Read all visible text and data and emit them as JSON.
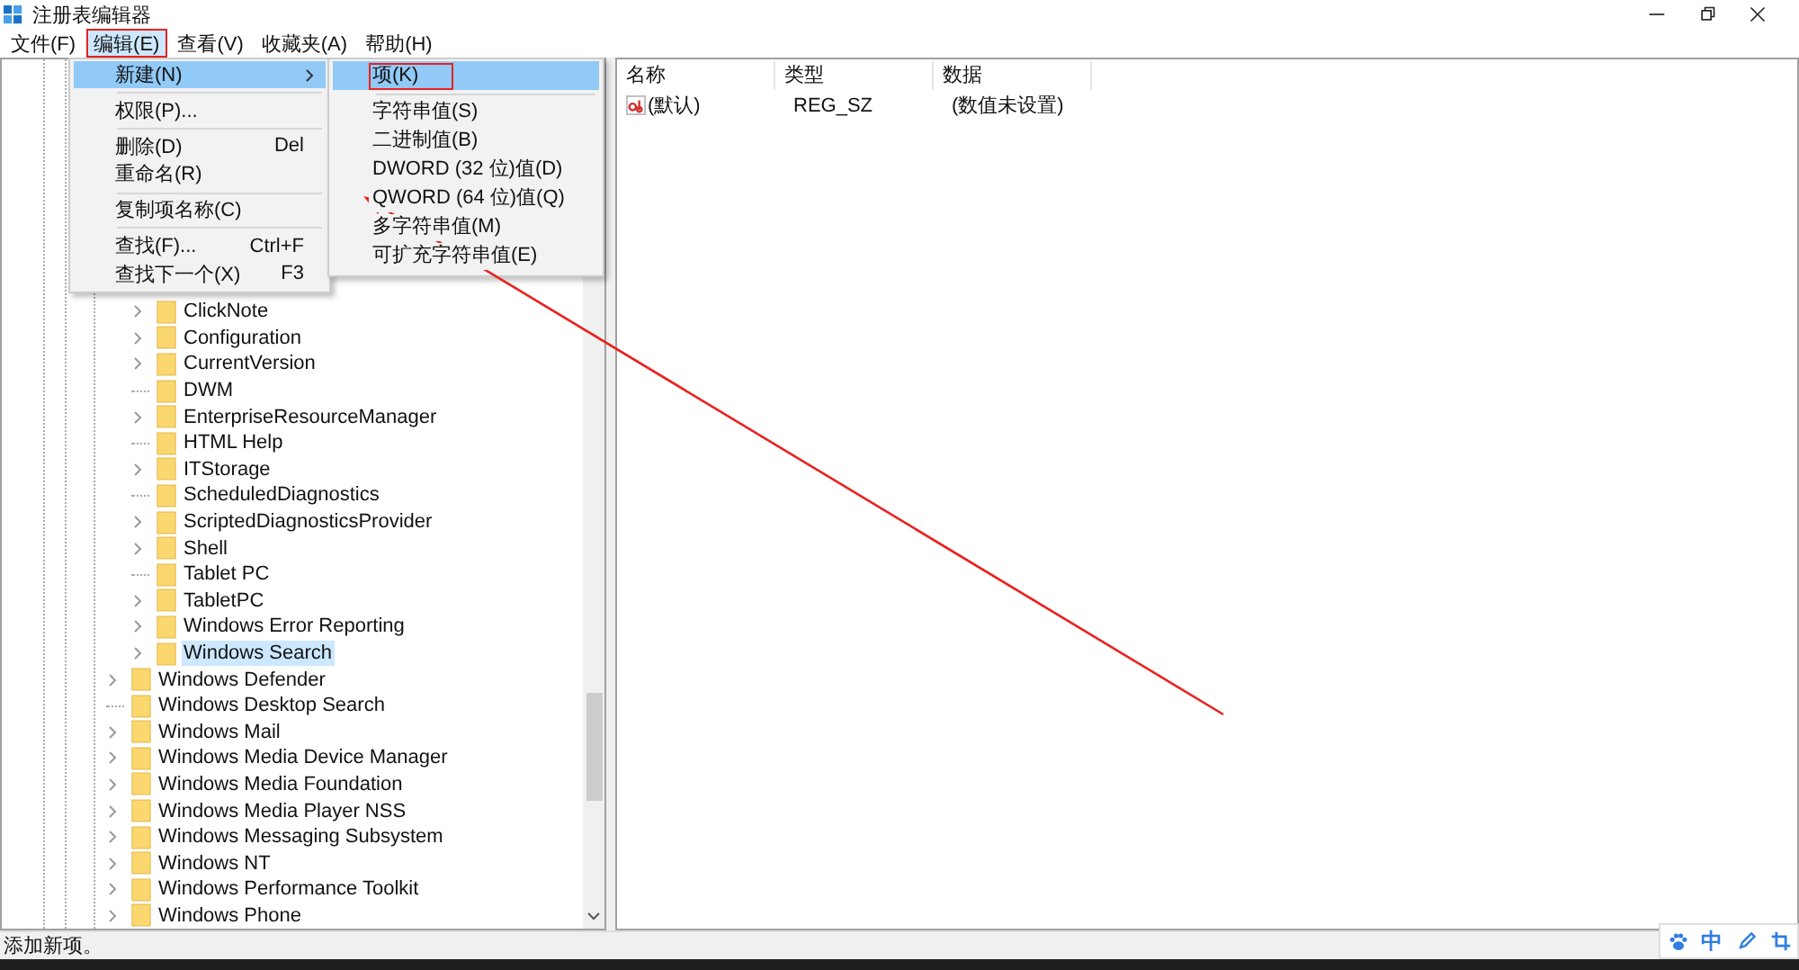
{
  "window": {
    "title": "注册表编辑器"
  },
  "menubar": [
    {
      "label": "文件(F)",
      "open": false,
      "annotated": false
    },
    {
      "label": "编辑(E)",
      "open": true,
      "annotated": true
    },
    {
      "label": "查看(V)",
      "open": false,
      "annotated": false
    },
    {
      "label": "收藏夹(A)",
      "open": false,
      "annotated": false
    },
    {
      "label": "帮助(H)",
      "open": false,
      "annotated": false
    }
  ],
  "edit_menu": [
    {
      "kind": "item",
      "label": "新建(N)",
      "submenu": true,
      "highlighted": true
    },
    {
      "kind": "separator"
    },
    {
      "kind": "item",
      "label": "权限(P)...",
      "submenu": false,
      "highlighted": false
    },
    {
      "kind": "separator"
    },
    {
      "kind": "item",
      "label": "删除(D)",
      "shortcut": "Del",
      "submenu": false,
      "highlighted": false
    },
    {
      "kind": "item",
      "label": "重命名(R)",
      "submenu": false,
      "highlighted": false
    },
    {
      "kind": "separator"
    },
    {
      "kind": "item",
      "label": "复制项名称(C)",
      "submenu": false,
      "highlighted": false
    },
    {
      "kind": "separator"
    },
    {
      "kind": "item",
      "label": "查找(F)...",
      "shortcut": "Ctrl+F",
      "submenu": false,
      "highlighted": false
    },
    {
      "kind": "item",
      "label": "查找下一个(X)",
      "shortcut": "F3",
      "submenu": false,
      "highlighted": false
    }
  ],
  "new_submenu": [
    {
      "kind": "item",
      "label": "项(K)",
      "highlighted": true,
      "annotated": true
    },
    {
      "kind": "separator"
    },
    {
      "kind": "item",
      "label": "字符串值(S)",
      "highlighted": false,
      "annotated": false
    },
    {
      "kind": "item",
      "label": "二进制值(B)",
      "highlighted": false,
      "annotated": false
    },
    {
      "kind": "item",
      "label": "DWORD (32 位)值(D)",
      "highlighted": false,
      "annotated": false
    },
    {
      "kind": "item",
      "label": "QWORD (64 位)值(Q)",
      "highlighted": false,
      "annotated": false
    },
    {
      "kind": "item",
      "label": "多字符串值(M)",
      "highlighted": false,
      "annotated": false
    },
    {
      "kind": "item",
      "label": "可扩充字符串值(E)",
      "highlighted": false,
      "annotated": false
    }
  ],
  "tree": {
    "items": [
      {
        "children": [
          {
            "label": "ClickNote",
            "expandable": true,
            "selected": false
          },
          {
            "label": "Configuration",
            "expandable": true,
            "selected": false
          },
          {
            "label": "CurrentVersion",
            "expandable": true,
            "selected": false
          },
          {
            "label": "DWM",
            "expandable": false,
            "selected": false
          },
          {
            "label": "EnterpriseResourceManager",
            "expandable": true,
            "selected": false
          },
          {
            "label": "HTML Help",
            "expandable": false,
            "selected": false
          },
          {
            "label": "ITStorage",
            "expandable": true,
            "selected": false
          },
          {
            "label": "ScheduledDiagnostics",
            "expandable": false,
            "selected": false
          },
          {
            "label": "ScriptedDiagnosticsProvider",
            "expandable": true,
            "selected": false
          },
          {
            "label": "Shell",
            "expandable": true,
            "selected": false
          },
          {
            "label": "Tablet PC",
            "expandable": false,
            "selected": false
          },
          {
            "label": "TabletPC",
            "expandable": true,
            "selected": false
          },
          {
            "label": "Windows Error Reporting",
            "expandable": true,
            "selected": false
          },
          {
            "label": "Windows Search",
            "expandable": true,
            "selected": true
          }
        ]
      },
      {
        "label": "Windows Defender",
        "expandable": true,
        "selected": false
      },
      {
        "label": "Windows Desktop Search",
        "expandable": false,
        "selected": false
      },
      {
        "label": "Windows Mail",
        "expandable": true,
        "selected": false
      },
      {
        "label": "Windows Media Device Manager",
        "expandable": true,
        "selected": false
      },
      {
        "label": "Windows Media Foundation",
        "expandable": true,
        "selected": false
      },
      {
        "label": "Windows Media Player NSS",
        "expandable": true,
        "selected": false
      },
      {
        "label": "Windows Messaging Subsystem",
        "expandable": true,
        "selected": false
      },
      {
        "label": "Windows NT",
        "expandable": true,
        "selected": false
      },
      {
        "label": "Windows Performance Toolkit",
        "expandable": true,
        "selected": false
      },
      {
        "label": "Windows Phone",
        "expandable": true,
        "selected": false
      }
    ]
  },
  "values_table": {
    "columns": [
      "名称",
      "类型",
      "数据"
    ],
    "rows": [
      {
        "name": "(默认)",
        "type": "REG_SZ",
        "data": "(数值未设置)"
      }
    ]
  },
  "status_bar": {
    "text": "添加新项。"
  },
  "ime_toolbar": {
    "mode": "中"
  }
}
